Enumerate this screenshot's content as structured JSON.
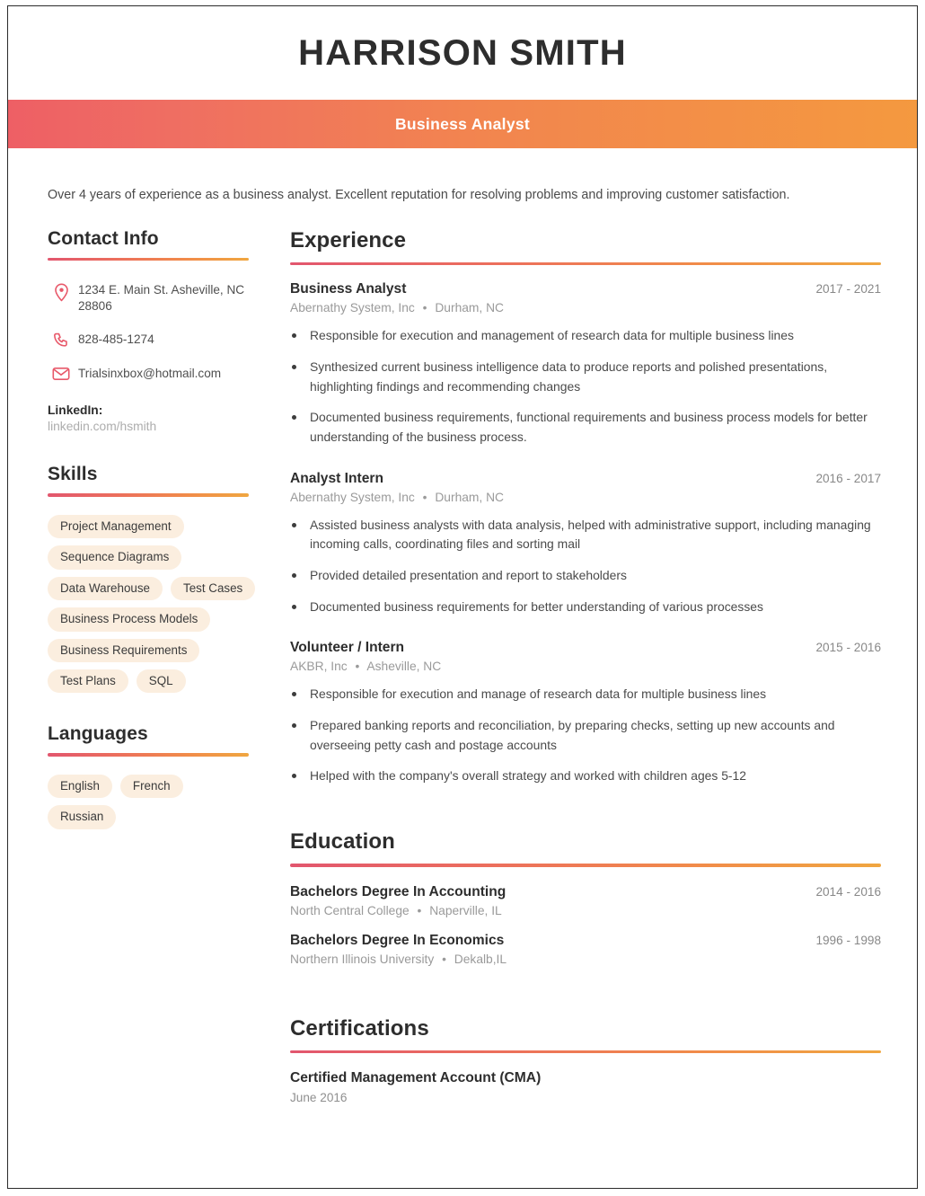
{
  "header": {
    "name": "HARRISON SMITH",
    "job_title": "Business Analyst",
    "gradient_start": "#ee5f65",
    "gradient_end": "#f4993f"
  },
  "summary": "Over 4 years of experience as a business analyst. Excellent reputation for resolving problems and improving customer satisfaction.",
  "sidebar": {
    "contact": {
      "heading": "Contact Info",
      "items": [
        {
          "icon": "location-pin-icon",
          "text": "1234 E. Main St. Asheville, NC 28806"
        },
        {
          "icon": "phone-icon",
          "text": "828-485-1274"
        },
        {
          "icon": "envelope-icon",
          "text": "Trialsinxbox@hotmail.com"
        }
      ],
      "linkedin_label": "LinkedIn:",
      "linkedin_url": "linkedin.com/hsmith"
    },
    "skills": {
      "heading": "Skills",
      "tags": [
        "Project Management",
        "Sequence Diagrams",
        "Data Warehouse",
        "Test Cases",
        "Business Process Models",
        "Business Requirements",
        "Test Plans",
        "SQL"
      ]
    },
    "languages": {
      "heading": "Languages",
      "tags": [
        "English",
        "French",
        "Russian"
      ]
    }
  },
  "main": {
    "experience": {
      "heading": "Experience",
      "entries": [
        {
          "role": "Business Analyst",
          "company": "Abernathy System, Inc",
          "location": "Durham, NC",
          "dates": "2017 - 2021",
          "bullets": [
            "Responsible for execution and management of research data for multiple business lines",
            "Synthesized current business intelligence data to produce reports and polished presentations, highlighting findings and recommending changes",
            "Documented business requirements, functional requirements and business process models for better understanding of the business process."
          ]
        },
        {
          "role": "Analyst Intern",
          "company": "Abernathy System, Inc",
          "location": "Durham, NC",
          "dates": "2016 - 2017",
          "bullets": [
            "Assisted business analysts with data analysis, helped with administrative support, including managing incoming calls, coordinating files and sorting mail",
            "Provided detailed presentation and report to stakeholders",
            "Documented business requirements for better understanding of various processes"
          ]
        },
        {
          "role": "Volunteer / Intern",
          "company": "AKBR, Inc",
          "location": "Asheville, NC",
          "dates": "2015 - 2016",
          "bullets": [
            "Responsible for execution and manage of research data for multiple business lines",
            "Prepared banking reports and reconciliation, by preparing checks, setting up new accounts and overseeing petty cash and postage accounts",
            "Helped with the company's overall strategy and worked with children ages 5-12"
          ]
        }
      ]
    },
    "education": {
      "heading": "Education",
      "entries": [
        {
          "degree": "Bachelors Degree In Accounting",
          "school": "North Central College",
          "location": "Naperville, IL",
          "dates": "2014 - 2016"
        },
        {
          "degree": "Bachelors Degree In Economics",
          "school": "Northern Illinois University",
          "location": "Dekalb,IL",
          "dates": "1996 - 1998"
        }
      ]
    },
    "certifications": {
      "heading": "Certifications",
      "entries": [
        {
          "name": "Certified Management Account (CMA)",
          "date": "June 2016"
        }
      ]
    }
  },
  "separator": "•"
}
